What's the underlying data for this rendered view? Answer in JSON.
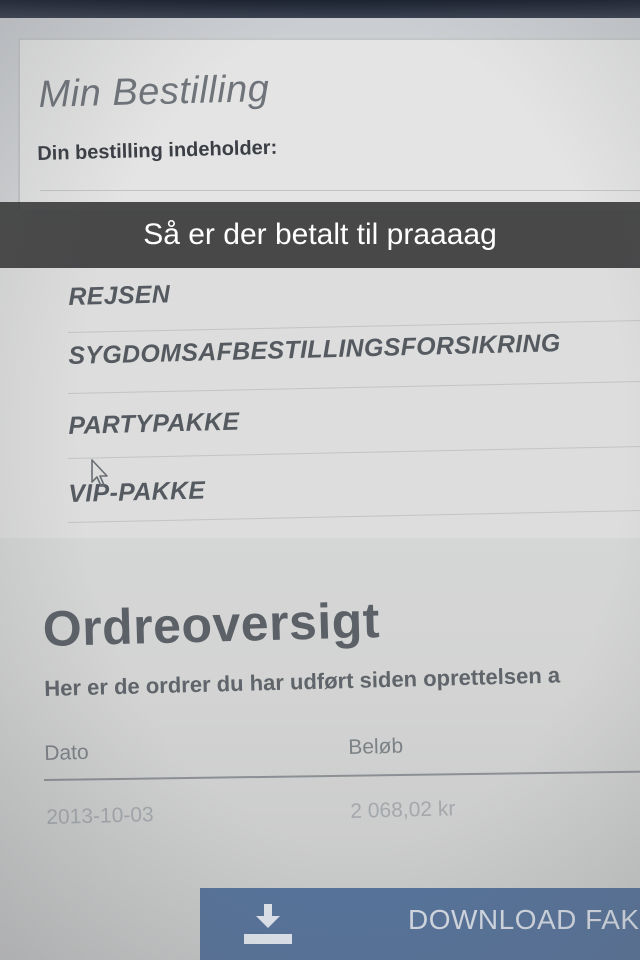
{
  "order_panel": {
    "title": "Min Bestilling",
    "subtitle": "Din bestilling indeholder:"
  },
  "order_items": [
    {
      "label": "REJSEN"
    },
    {
      "label": "SYGDOMSAFBESTILLINGSFORSIKRING"
    },
    {
      "label": "PARTYPAKKE"
    },
    {
      "label": "VIP-PAKKE"
    }
  ],
  "order_overview": {
    "title": "Ordreoversigt",
    "description": "Her er de ordrer du har udført siden oprettelsen a",
    "columns": {
      "date": "Dato",
      "amount": "Beløb"
    },
    "rows": [
      {
        "date": "2013-10-03",
        "amount": "2 068,02 kr"
      }
    ]
  },
  "download_button": {
    "label": "DOWNLOAD FAK",
    "icon": "download-icon"
  },
  "snap_caption": "Så er der betalt til praaaag",
  "colors": {
    "button_bg": "#57739a",
    "caption_bg": "#282828"
  }
}
